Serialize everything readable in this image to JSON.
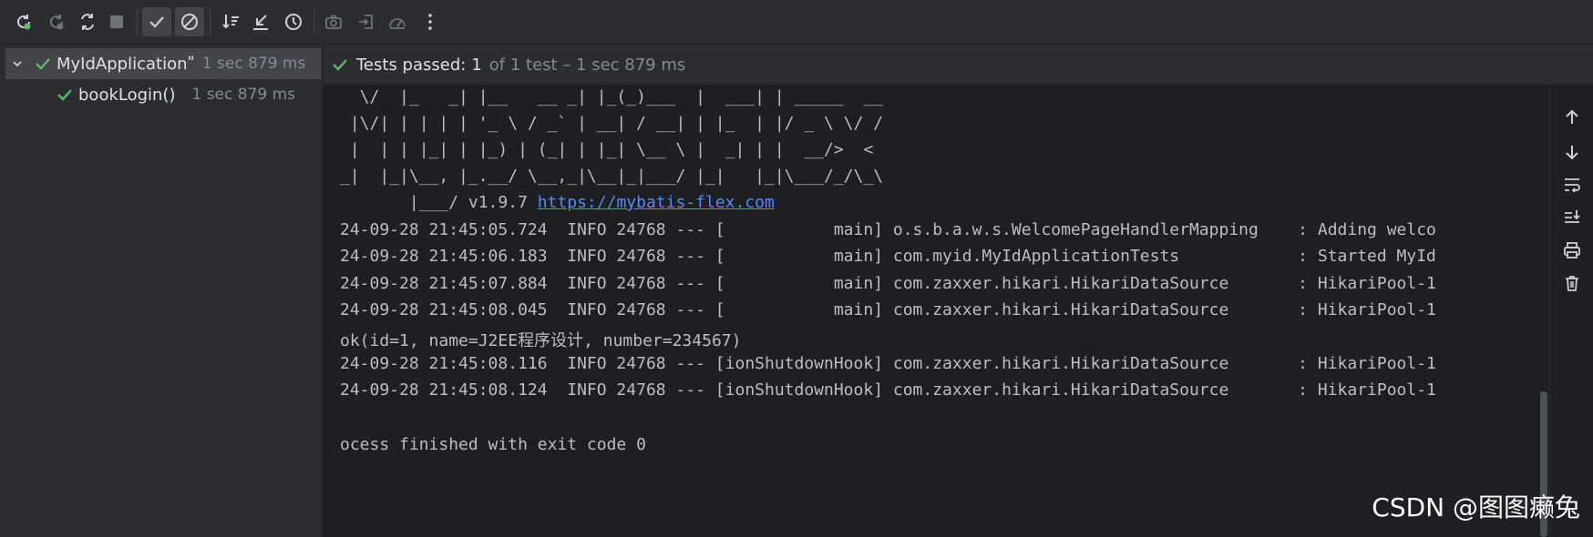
{
  "tree": {
    "root": {
      "name": "MyIdApplicationʺ",
      "duration": "1 sec 879 ms"
    },
    "child": {
      "name": "bookLogin()",
      "duration": "1 sec 879 ms"
    }
  },
  "status": {
    "label": "Tests passed:",
    "count": "1",
    "rest": "of 1 test – 1 sec 879 ms"
  },
  "console": {
    "banner": [
      "  \\/  |_   _| |__   __ _| |_(_)___  |  ___| | _____  __",
      " |\\/| | | | | '_ \\ / _` | __| / __| | |_  | |/ _ \\ \\/ /",
      " |  | | |_| | |_) | (_| | |_| \\__ \\ |  _| | |  __/>  <",
      "_|  |_|\\__, |_.__/ \\__,_|\\__|_|___/ |_|   |_|\\___/_/\\_\\"
    ],
    "version_prefix": "       |___/ v1.9.7 ",
    "version_link": "https://mybatis-flex.com",
    "log": [
      "24-09-28 21:45:05.724  INFO 24768 --- [           main] o.s.b.a.w.s.WelcomePageHandlerMapping    : Adding welco",
      "24-09-28 21:45:06.183  INFO 24768 --- [           main] com.myid.MyIdApplicationTests            : Started MyId",
      "24-09-28 21:45:07.884  INFO 24768 --- [           main] com.zaxxer.hikari.HikariDataSource       : HikariPool-1",
      "24-09-28 21:45:08.045  INFO 24768 --- [           main] com.zaxxer.hikari.HikariDataSource       : HikariPool-1",
      "ok(id=1, name=J2EE程序设计, number=234567)",
      "24-09-28 21:45:08.116  INFO 24768 --- [ionShutdownHook] com.zaxxer.hikari.HikariDataSource       : HikariPool-1",
      "24-09-28 21:45:08.124  INFO 24768 --- [ionShutdownHook] com.zaxxer.hikari.HikariDataSource       : HikariPool-1"
    ],
    "exit": "ocess finished with exit code 0"
  },
  "watermark": "CSDN @图图癞兔",
  "colors": {
    "green": "#5fb865",
    "icon": "#ced0d6",
    "disabled": "#6f737a"
  },
  "icons": {
    "toolbar": [
      "rerun-icon",
      "rerun-failed-icon",
      "toggle-autotest-icon",
      "stop-icon",
      "show-passed-icon",
      "show-ignored-icon",
      "sort-icon",
      "collapse-icon",
      "history-icon",
      "snapshot-icon",
      "import-icon",
      "coverage-icon",
      "more-icon"
    ],
    "side": [
      "up-arrow-icon",
      "down-arrow-icon",
      "soft-wrap-icon",
      "scroll-to-end-icon",
      "print-icon",
      "trash-icon"
    ]
  }
}
